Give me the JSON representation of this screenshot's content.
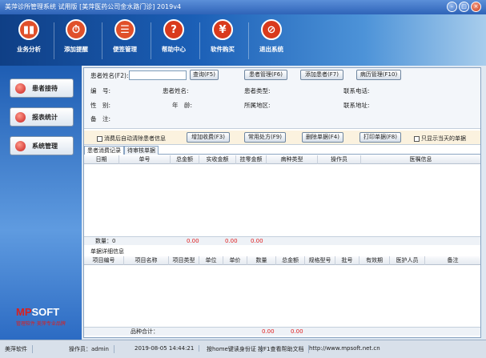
{
  "window": {
    "title": "美萍诊所管理系统 试用版 [美萍医药公司金水路门诊] 2019v4",
    "controls": {
      "minimize": "–",
      "maximize": "□",
      "close": "×"
    }
  },
  "toolbar": [
    {
      "label": "业务分析",
      "icon": "bar-chart-icon",
      "glyph": "▮▮"
    },
    {
      "label": "添加提醒",
      "icon": "clock-icon",
      "glyph": "⏱"
    },
    {
      "label": "便签管理",
      "icon": "notepad-icon",
      "glyph": "☰"
    },
    {
      "label": "帮助中心",
      "icon": "help-icon",
      "glyph": "?"
    },
    {
      "label": "软件购买",
      "icon": "yen-icon",
      "glyph": "¥"
    },
    {
      "label": "退出系统",
      "icon": "exit-icon",
      "glyph": "⊘"
    }
  ],
  "sidebar": {
    "items": [
      {
        "label": "患者接待"
      },
      {
        "label": "报表统计"
      },
      {
        "label": "系统管理"
      }
    ],
    "logo": {
      "brand_a": "MP",
      "brand_b": "SOFT",
      "slogan": "管理软件 美萍专业品牌"
    }
  },
  "search": {
    "label": "患者姓名(F2):",
    "value": "",
    "query_btn": "查询(F5)",
    "manage_btn": "患者管理(F6)",
    "add_btn": "添加患者(F7)",
    "record_btn": "病历管理(F10)"
  },
  "patient_fields": {
    "id": "编　号:",
    "name": "患者姓名:",
    "type": "患者类型:",
    "phone": "联系电话:",
    "gender": "性　别:",
    "age": "年　龄:",
    "region": "所属地区:",
    "address": "联系地址:",
    "note": "备　注:"
  },
  "actions": {
    "auto_clear": "消费后自动清除患者信息",
    "add_charge": "增加收费(F3)",
    "common_rx": "常用处方(F9)",
    "delete_bill": "删除单据(F4)",
    "print_bill": "打印单据(F8)",
    "today_only": "只显示当天的单据"
  },
  "tabs": [
    "患者消费记录",
    "待审核单据"
  ],
  "bill_table": {
    "columns": [
      "日期",
      "单号",
      "总金额",
      "实收金额",
      "挂零金额",
      "病种类型",
      "操作员",
      "医嘱信息"
    ],
    "rows": [],
    "footer": {
      "count_label": "数量：0",
      "total": "0.00",
      "received": "0.00",
      "rounding": "0.00"
    }
  },
  "detail_section_label": "单据详细信息",
  "detail_table": {
    "columns": [
      "项目编号",
      "项目名称",
      "项目类型",
      "单位",
      "单价",
      "数量",
      "总金额",
      "规格型号",
      "批号",
      "有效期",
      "医护人员",
      "备注"
    ],
    "rows": [],
    "footer": {
      "label": "品种合计：",
      "qty": "0.00",
      "amount": "0.00"
    }
  },
  "statusbar": {
    "app": "美萍软件",
    "operator": "操作员：admin",
    "datetime": "2019-08-05 14:44:21",
    "hint1": "按home键读身份证",
    "hint2": "按F1查看帮助文档",
    "url": "http://www.mpsoft.net.cn"
  }
}
